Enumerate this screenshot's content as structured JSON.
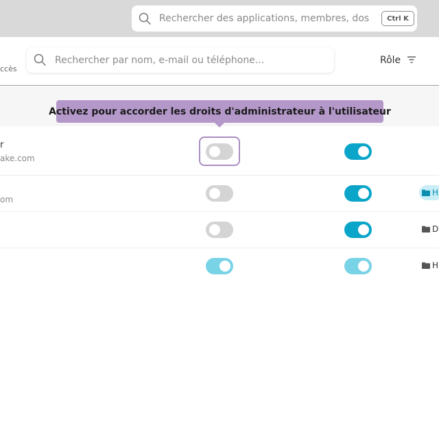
{
  "global_search": {
    "placeholder": "Rechercher des applications, membres, doss",
    "shortcut": "Ctrl K"
  },
  "toolbar": {
    "access_tab_partial": "ccès",
    "member_search_placeholder": "Rechercher par nom, e-mail ou téléphone...",
    "role_filter_label": "Rôle"
  },
  "tooltip": {
    "text": "Activez pour accorder les droits d'administrateur à l'utilisateur"
  },
  "rows": [
    {
      "name_partial": "r",
      "email_partial": "ake.com",
      "admin_enabled": false,
      "access_enabled": true,
      "folder_partial": ""
    },
    {
      "name_partial": "",
      "email_partial": "om",
      "admin_enabled": false,
      "access_enabled": true,
      "folder_partial": "H"
    },
    {
      "name_partial": "",
      "email_partial": "",
      "admin_enabled": false,
      "access_enabled": true,
      "folder_partial": "D"
    },
    {
      "name_partial": "",
      "email_partial": "",
      "admin_enabled": true,
      "access_enabled": true,
      "folder_partial": "H"
    }
  ],
  "colors": {
    "toggle_on": "#0aa5c9",
    "toggle_on_disabled": "#79d3e6",
    "toggle_off": "#d4d4d4",
    "tooltip_bg": "#b598ca",
    "focus_ring": "#a98cc1"
  },
  "icons": {
    "search": "search-icon",
    "filter": "filter-icon",
    "folder": "folder-icon"
  }
}
